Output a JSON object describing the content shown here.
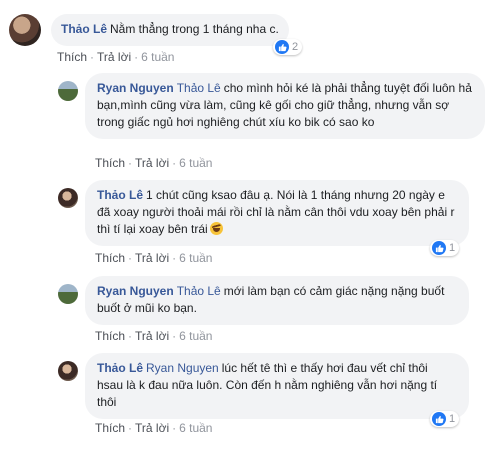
{
  "actions": {
    "like": "Thích",
    "reply": "Trả lời",
    "sep": "·"
  },
  "comments": [
    {
      "author": "Thảo Lê",
      "mention": "",
      "text": "Nằm thẳng trong 1 tháng nha c.",
      "time": "6 tuần",
      "reactions": "2"
    },
    {
      "author": "Ryan Nguyen",
      "mention": "Thảo Lê",
      "text": "cho mình hỏi ké là phải thẳng tuyệt đối luôn hả bạn,mình cũng vừa làm, cũng kê gối cho giữ thẳng, nhưng vẫn sợ trong giấc ngủ hơi nghiêng chút xíu ko bik có sao ko",
      "time": "6 tuần",
      "reactions": ""
    },
    {
      "author": "Thảo Lê",
      "mention": "",
      "text": "1 chút cũng ksao đâu ạ. Nói là 1 tháng nhưng 20 ngày e đã xoay người thoải mái rồi chỉ là nằm cân thôi vdu xoay bên phải r thì tí lại xoay bên trái",
      "time": "6 tuần",
      "reactions": "1"
    },
    {
      "author": "Ryan Nguyen",
      "mention": "Thảo Lê",
      "text": "mới làm bạn có cảm giác nặng nặng buốt buốt ở mũi ko bạn.",
      "time": "6 tuần",
      "reactions": ""
    },
    {
      "author": "Thảo Lê",
      "mention": "Ryan Nguyen",
      "text": "lúc hết tê thì e thấy hơi đau vết chỉ thôi hsau là k đau nữa luôn. Còn đến h nằm nghiêng vẫn hơi nặng tí thôi",
      "time": "6 tuần",
      "reactions": "1"
    }
  ]
}
